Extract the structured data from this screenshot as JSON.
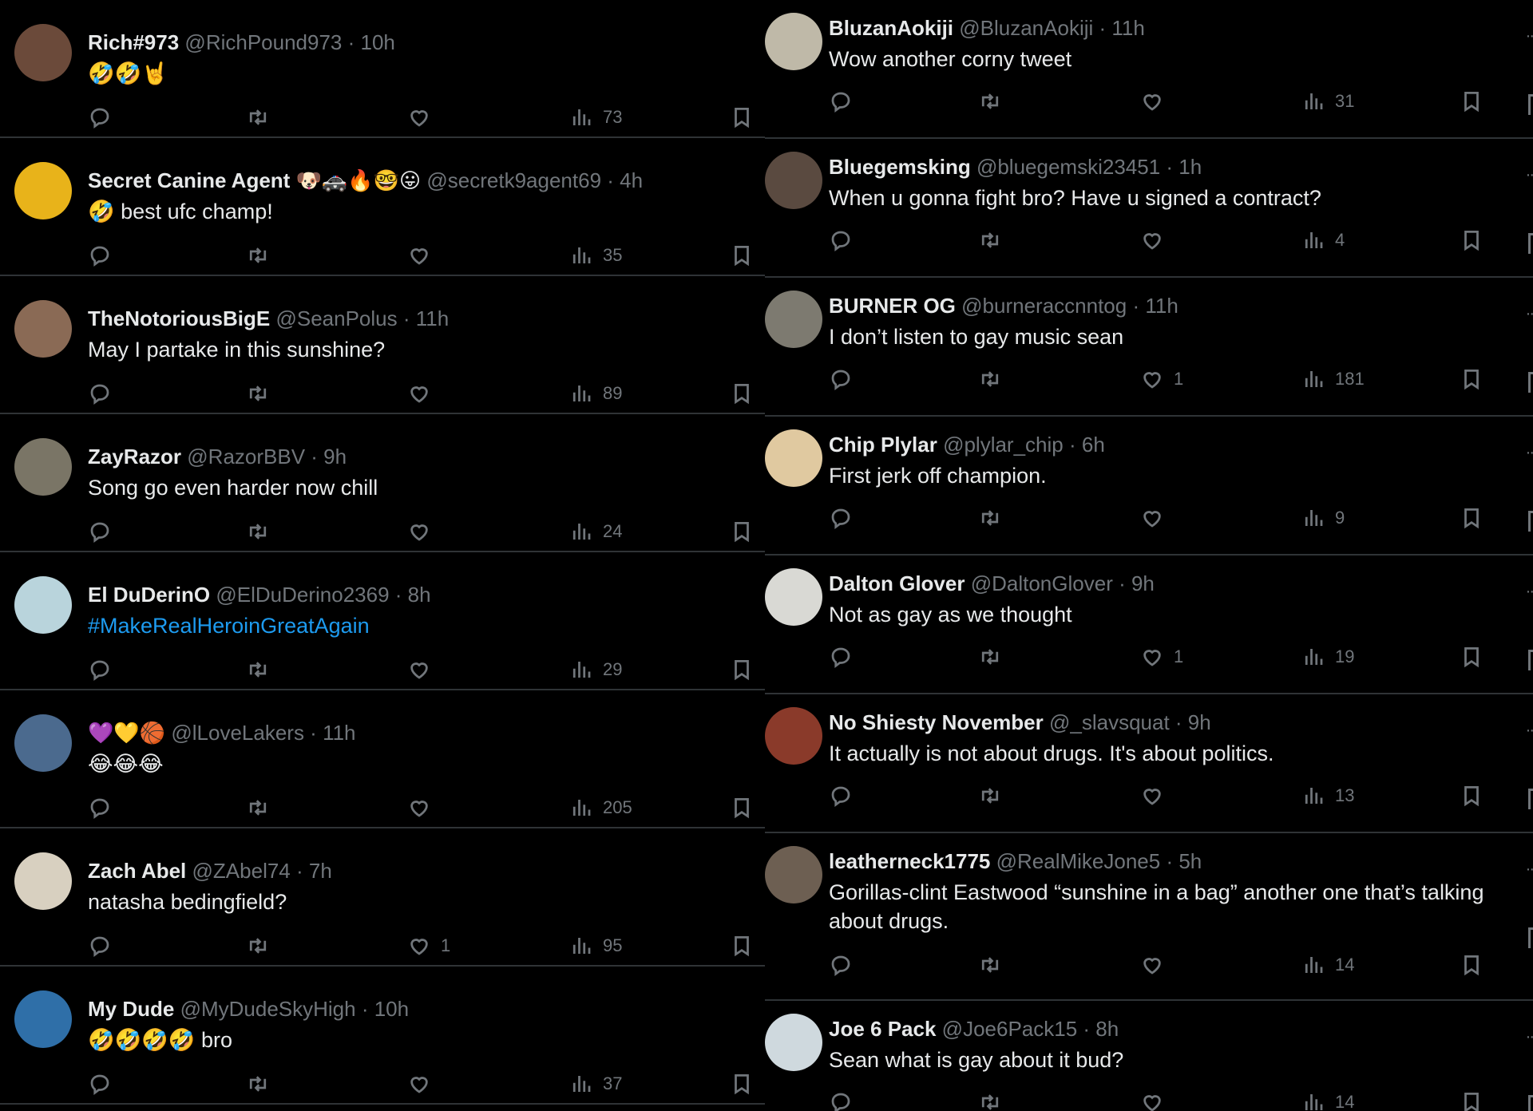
{
  "left_column": [
    {
      "name": "Rich#973",
      "handle": "@RichPound973",
      "time": "10h",
      "text": "🤣🤣🤘",
      "link": false,
      "likes": "",
      "views": "73",
      "avatar_color": "#6b4a3a"
    },
    {
      "name": "Secret Canine Agent 🐶🚓🔥🤓😛",
      "handle": "@secretk9agent69",
      "time": "4h",
      "text": "🤣 best ufc champ!",
      "link": false,
      "likes": "",
      "views": "35",
      "avatar_color": "#e8b31a"
    },
    {
      "name": "TheNotoriousBigE",
      "handle": "@SeanPolus",
      "time": "11h",
      "text": "May I partake in this sunshine?",
      "link": false,
      "likes": "",
      "views": "89",
      "avatar_color": "#8a6a55"
    },
    {
      "name": "ZayRazor",
      "handle": "@RazorBBV",
      "time": "9h",
      "text": "Song go even harder now chill",
      "link": false,
      "likes": "",
      "views": "24",
      "avatar_color": "#7a7566"
    },
    {
      "name": "El DuDerinO",
      "handle": "@ElDuDerino2369",
      "time": "8h",
      "text": "#MakeRealHeroinGreatAgain",
      "link": true,
      "likes": "",
      "views": "29",
      "avatar_color": "#b9d4dc"
    },
    {
      "name": "💜💛🏀",
      "handle": "@lLoveLakers",
      "time": "11h",
      "text": "😂😂😂",
      "link": false,
      "likes": "",
      "views": "205",
      "avatar_color": "#4b6a8e"
    },
    {
      "name": "Zach Abel",
      "handle": "@ZAbel74",
      "time": "7h",
      "text": "natasha bedingfield?",
      "link": false,
      "likes": "1",
      "views": "95",
      "avatar_color": "#d8d0c0"
    },
    {
      "name": "My Dude",
      "handle": "@MyDudeSkyHigh",
      "time": "10h",
      "text": "🤣🤣🤣🤣 bro",
      "link": false,
      "likes": "",
      "views": "37",
      "avatar_color": "#2f6fa8"
    }
  ],
  "right_column": [
    {
      "name": "BluzanAokiji",
      "handle": "@BluzanAokiji",
      "time": "11h",
      "text": "Wow another corny tweet",
      "likes": "",
      "views": "31",
      "tall": false,
      "avatar_color": "#bfb9a8"
    },
    {
      "name": "Bluegemsking",
      "handle": "@bluegemski23451",
      "time": "1h",
      "text": "When u gonna fight bro? Have u signed a contract?",
      "likes": "",
      "views": "4",
      "tall": false,
      "avatar_color": "#5a4a40"
    },
    {
      "name": "BURNER OG",
      "handle": "@burneraccnntog",
      "time": "11h",
      "text": "I don’t listen to gay music sean",
      "likes": "1",
      "views": "181",
      "tall": false,
      "avatar_color": "#7d7a70"
    },
    {
      "name": "Chip Plylar",
      "handle": "@plylar_chip",
      "time": "6h",
      "text": "First jerk off champion.",
      "likes": "",
      "views": "9",
      "tall": false,
      "avatar_color": "#e0c9a0"
    },
    {
      "name": "Dalton Glover",
      "handle": "@DaltonGlover",
      "time": "9h",
      "text": "Not as gay as we thought",
      "likes": "1",
      "views": "19",
      "tall": false,
      "avatar_color": "#d9d9d4"
    },
    {
      "name": "No Shiesty November",
      "handle": "@_slavsquat",
      "time": "9h",
      "text": "It actually is not about drugs. It's about politics.",
      "likes": "",
      "views": "13",
      "tall": false,
      "avatar_color": "#8a3a2a"
    },
    {
      "name": "leatherneck1775",
      "handle": "@RealMikeJone5",
      "time": "5h",
      "text": "Gorillas-clint Eastwood “sunshine in a bag” another one that’s talking about drugs.",
      "likes": "",
      "views": "14",
      "tall": true,
      "avatar_color": "#6d5f52"
    },
    {
      "name": "Joe 6 Pack",
      "handle": "@Joe6Pack15",
      "time": "8h",
      "text": "Sean what is gay about it bud?",
      "likes": "",
      "views": "14",
      "tall": false,
      "avatar_color": "#cfd9de"
    }
  ],
  "icons": {
    "reply": "reply-icon",
    "retweet": "retweet-icon",
    "like": "heart-icon",
    "views": "views-icon",
    "bookmark": "bookmark-icon",
    "more": "more-icon"
  }
}
